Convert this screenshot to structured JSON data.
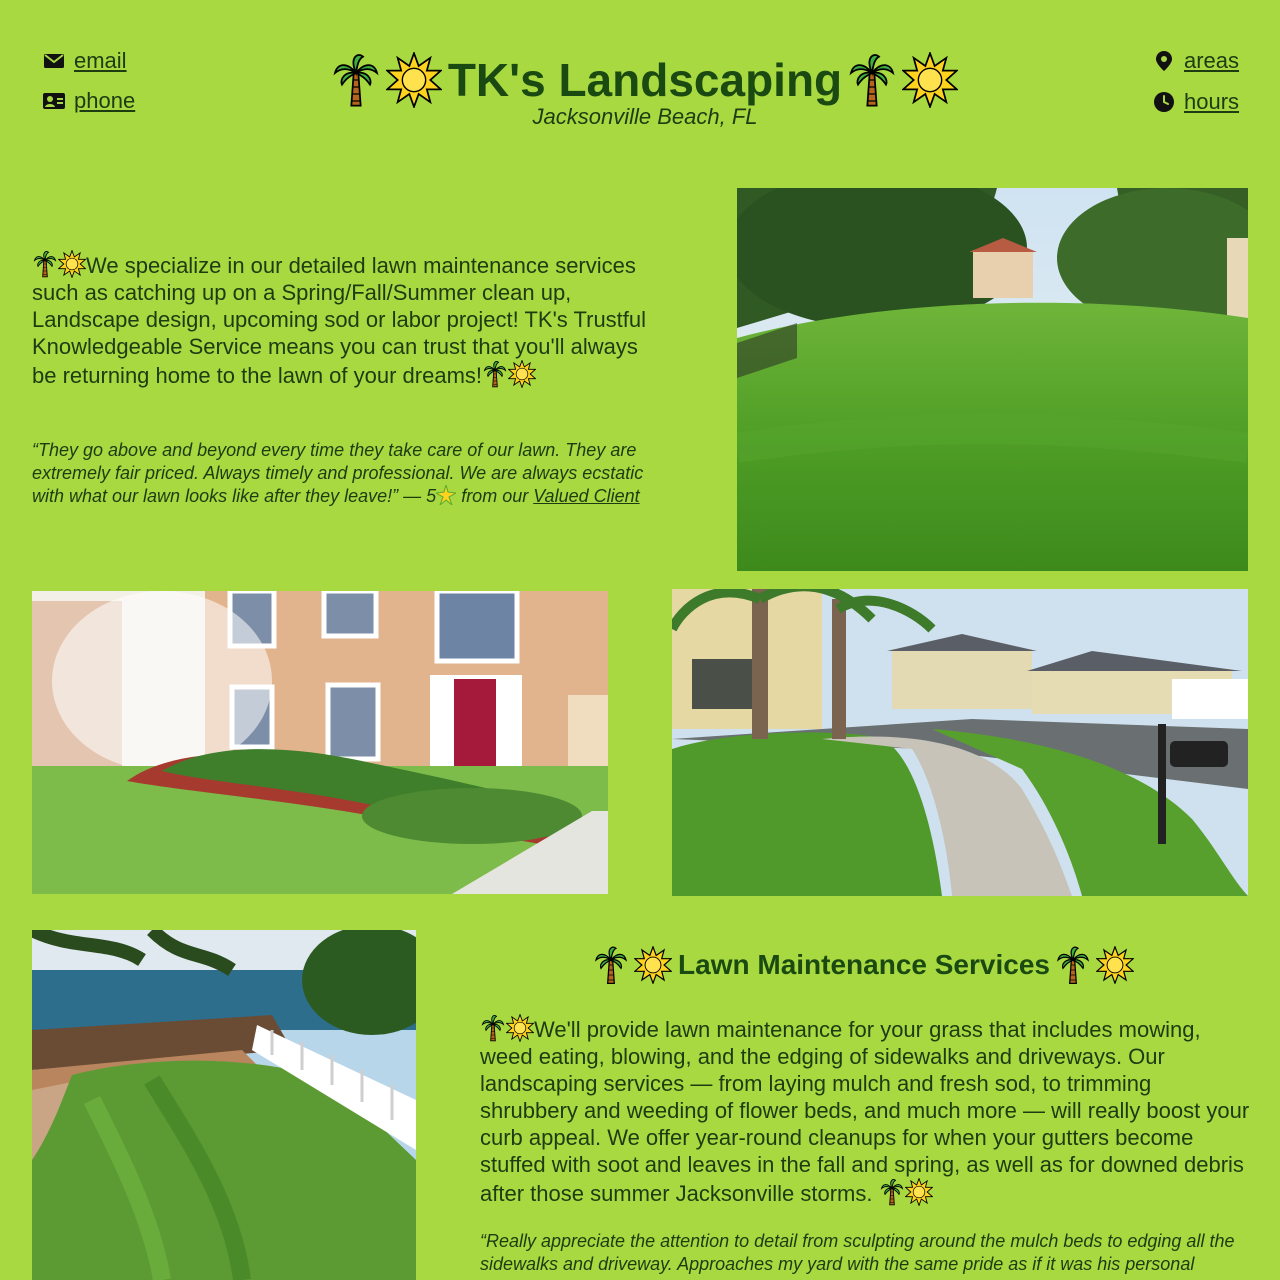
{
  "nav": {
    "email": "email",
    "phone": "phone",
    "areas": "areas",
    "hours": "hours"
  },
  "header": {
    "title": "TK's Landscaping",
    "subtitle": "Jacksonville Beach, FL"
  },
  "intro": {
    "text": "We specialize in our detailed lawn maintenance services such as catching up on a Spring/Fall/Summer clean up, Landscape design, upcoming sod or labor project! TK's Trustful Knowledgeable Service means you can trust that you'll always be returning home to the lawn of your dreams!",
    "quote": "“They go above and beyond every time they take care of our lawn. They are extremely fair priced. Always timely and professional. We are always ecstatic with what our lawn looks like after they leave!” — 5",
    "quote_suffix": " from our ",
    "quote_link": "Valued Client"
  },
  "services": {
    "title": "Lawn Maintenance Services",
    "text": "We'll provide lawn maintenance for your grass that includes mowing, weed eating, blowing, and the edging of sidewalks and driveways. Our landscaping services — from laying mulch and fresh sod, to trimming shrubbery and weeding of flower beds, and much more — will really boost your curb appeal. We offer year-round cleanups for when your gutters become stuffed with soot and leaves in the fall and spring, as well as for downed debris after those summer Jacksonville storms.",
    "quote": "“Really appreciate the attention to detail from sculpting around the mulch beds to edging all the sidewalks and driveway. Approaches my yard with the same pride as if it was his personal"
  },
  "icons": {
    "email": "envelope-icon",
    "phone": "contact-card-icon",
    "areas": "map-pin-icon",
    "hours": "clock-icon",
    "decor": [
      "palm-tree-icon",
      "sun-icon"
    ]
  },
  "colors": {
    "background": "#a8d940",
    "title": "#1a4a12",
    "text": "#1e3b12"
  }
}
